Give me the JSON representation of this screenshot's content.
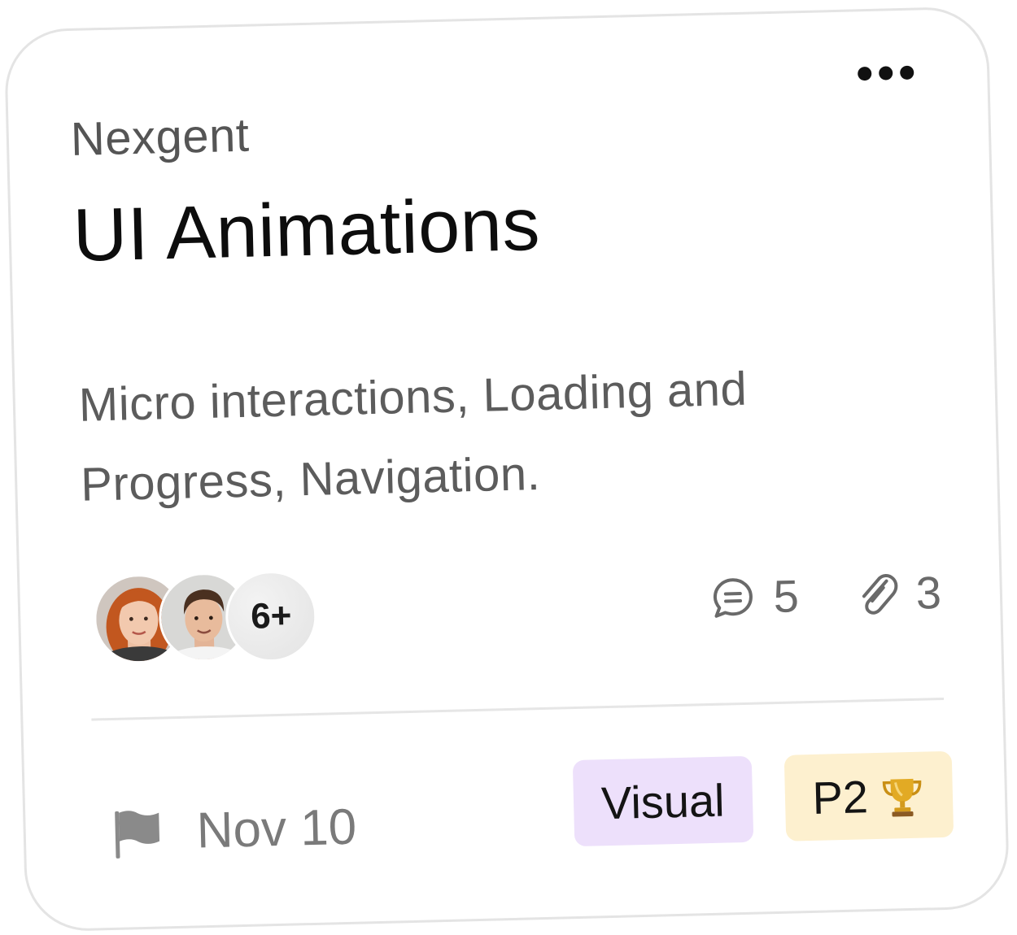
{
  "card": {
    "organization": "Nexgent",
    "title": "UI Animations",
    "description": "Micro interactions, Loading and Progress, Navigation.",
    "more_icon": "ellipsis-horizontal-icon"
  },
  "members": {
    "avatars": [
      "woman-red-hair-avatar",
      "man-brown-hair-avatar"
    ],
    "extra_count": "6+"
  },
  "stats": {
    "comments": {
      "icon": "comment-icon",
      "count": "5"
    },
    "attachments": {
      "icon": "paperclip-icon",
      "count": "3"
    }
  },
  "footer": {
    "due_icon": "flag-icon",
    "due_date": "Nov 10",
    "tags": [
      {
        "label": "Visual",
        "color": "#ede0fb"
      },
      {
        "label": "P2",
        "icon": "trophy-icon",
        "color": "#fdf0cf"
      }
    ]
  },
  "colors": {
    "border": "#e4e4e4",
    "title": "#0d0d0d",
    "muted": "#5c5c5c",
    "flag": "#8a8a8a",
    "trophy": "#d9a21b"
  }
}
